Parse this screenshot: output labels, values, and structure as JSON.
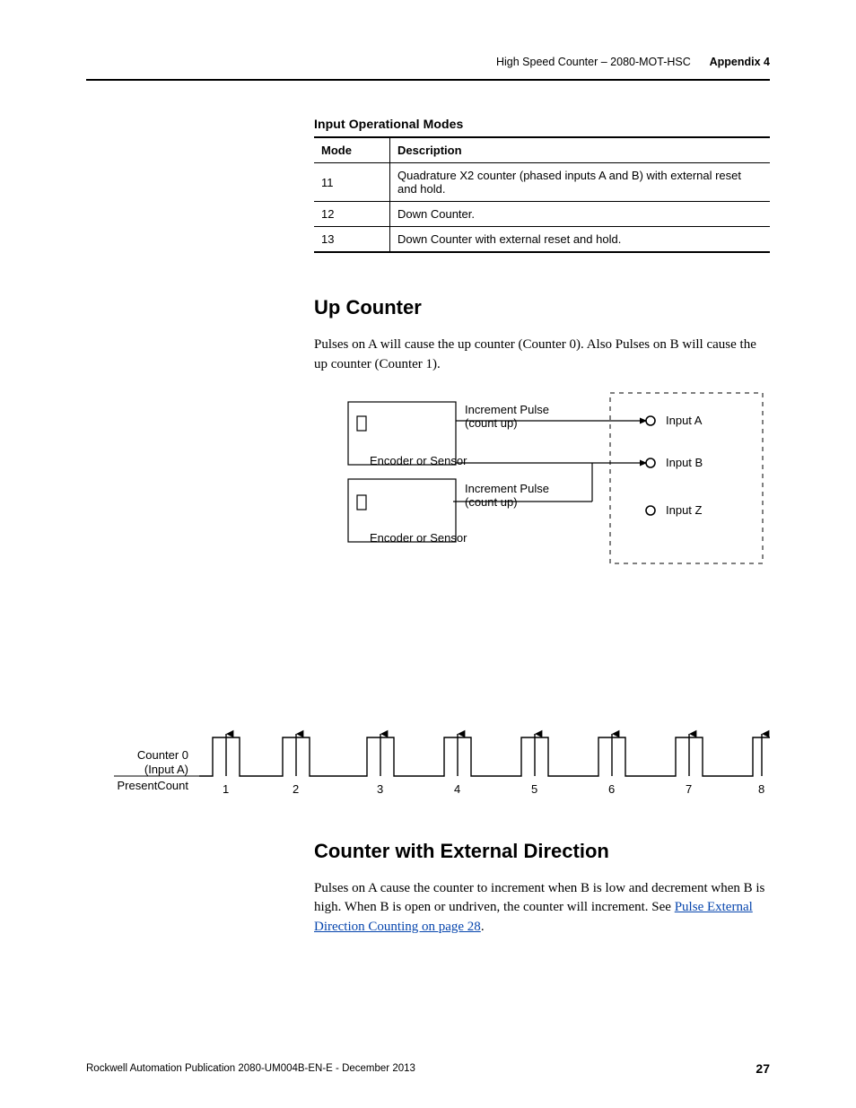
{
  "runningHead": {
    "left": "High Speed Counter – 2080-MOT-HSC",
    "right": "Appendix 4"
  },
  "tableTitle": "Input Operational Modes",
  "tableHeaders": {
    "mode": "Mode",
    "desc": "Description"
  },
  "tableRows": [
    {
      "mode": "11",
      "desc": "Quadrature X2 counter (phased inputs A and B) with external reset and hold."
    },
    {
      "mode": "12",
      "desc": "Down Counter."
    },
    {
      "mode": "13",
      "desc": "Down Counter with external reset and hold."
    }
  ],
  "sec1": {
    "title": "Up Counter",
    "para": "Pulses on A will cause the up counter (Counter 0). Also Pulses on B will cause the up counter (Counter 1)."
  },
  "fig1": {
    "incPulse": "Increment Pulse",
    "countUp": "(count up)",
    "encoder": "Encoder or Sensor",
    "inA": "Input A",
    "inB": "Input B",
    "inZ": "Input Z",
    "leftTop": "Counter 0",
    "leftMid": "(Input A)",
    "leftBot": "PresentCount",
    "nums": [
      "1",
      "2",
      "3",
      "4",
      "5",
      "6",
      "7",
      "8"
    ]
  },
  "sec2": {
    "title": "Counter with External Direction",
    "paraBefore": "Pulses on A cause the counter to increment when B is low and decrement when B is high. When B is open or undriven, the counter will increment. See ",
    "linkText": "Pulse External Direction Counting on page 28",
    "paraAfter": "."
  },
  "footer": {
    "left": "Rockwell Automation Publication 2080-UM004B-EN-E - December 2013",
    "right": "27"
  }
}
